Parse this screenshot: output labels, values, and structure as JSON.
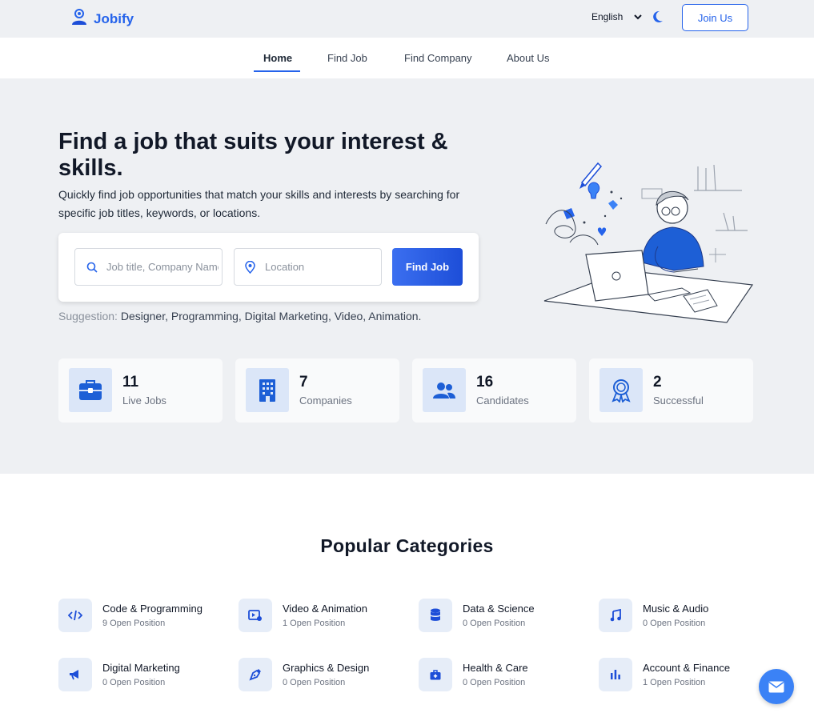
{
  "header": {
    "logo_text": "Jobify",
    "language": "English",
    "join_label": "Join Us"
  },
  "nav": {
    "items": [
      {
        "label": "Home"
      },
      {
        "label": "Find Job"
      },
      {
        "label": "Find Company"
      },
      {
        "label": "About Us"
      }
    ]
  },
  "hero": {
    "title": "Find a job that suits your interest & skills.",
    "subtitle": "Quickly find job opportunities that match your skills and interests by searching for specific job titles, keywords, or locations.",
    "search": {
      "keyword_placeholder": "Job title, Company Name",
      "location_placeholder": "Location",
      "button_label": "Find Job"
    },
    "suggestion_label": "Suggestion:",
    "suggestion_text": "Designer, Programming, Digital Marketing, Video, Animation."
  },
  "stats": [
    {
      "value": "11",
      "label": "Live Jobs",
      "icon": "briefcase-icon"
    },
    {
      "value": "7",
      "label": "Companies",
      "icon": "building-icon"
    },
    {
      "value": "16",
      "label": "Candidates",
      "icon": "users-icon"
    },
    {
      "value": "2",
      "label": "Successful",
      "icon": "award-icon"
    }
  ],
  "categories": {
    "title": "Popular Categories",
    "items": [
      {
        "name": "Code & Programming",
        "count": "9 Open Position",
        "icon": "code-icon"
      },
      {
        "name": "Video & Animation",
        "count": "1 Open Position",
        "icon": "video-icon"
      },
      {
        "name": "Data & Science",
        "count": "0 Open Position",
        "icon": "database-icon"
      },
      {
        "name": "Music & Audio",
        "count": "0 Open Position",
        "icon": "music-icon"
      },
      {
        "name": "Digital Marketing",
        "count": "0 Open Position",
        "icon": "megaphone-icon"
      },
      {
        "name": "Graphics & Design",
        "count": "0 Open Position",
        "icon": "pen-nib-icon"
      },
      {
        "name": "Health & Care",
        "count": "0 Open Position",
        "icon": "medical-kit-icon"
      },
      {
        "name": "Account & Finance",
        "count": "1 Open Position",
        "icon": "bar-chart-icon"
      }
    ]
  },
  "colors": {
    "accent": "#2563eb",
    "hero_bg": "#eef0f3",
    "icon_bg": "#dbe6f8"
  }
}
